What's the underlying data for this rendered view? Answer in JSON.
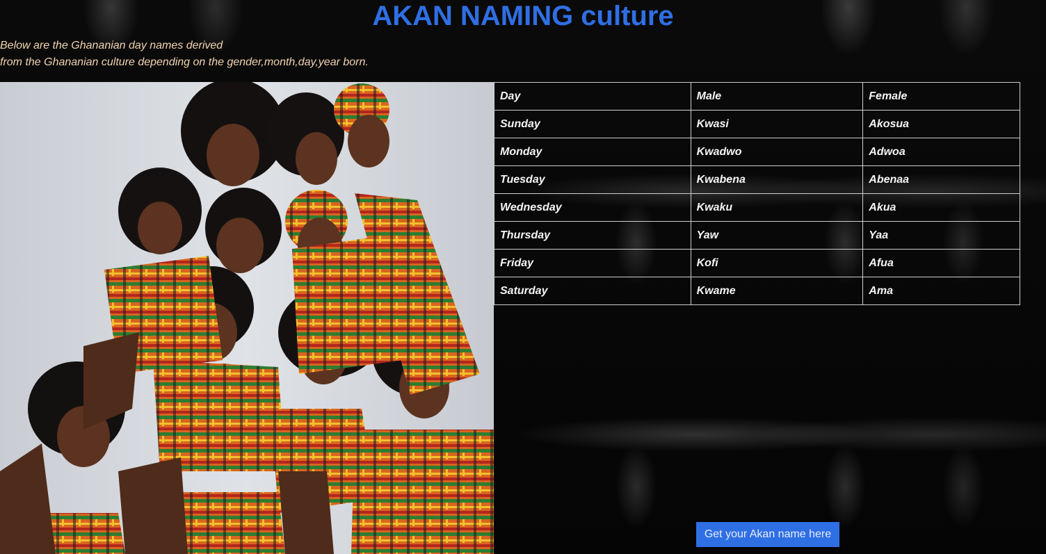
{
  "page": {
    "title": "AKAN NAMING culture",
    "intro_line1": "Below are the Ghananian day names derived",
    "intro_line2": "from the Ghananian culture depending on the gender,month,day,year born."
  },
  "table": {
    "headers": {
      "day": "Day",
      "male": "Male",
      "female": "Female"
    },
    "rows": [
      {
        "day": "Sunday",
        "male": "Kwasi",
        "female": "Akosua"
      },
      {
        "day": "Monday",
        "male": "Kwadwo",
        "female": "Adwoa"
      },
      {
        "day": "Tuesday",
        "male": "Kwabena",
        "female": "Abenaa"
      },
      {
        "day": "Wednesday",
        "male": "Kwaku",
        "female": "Akua"
      },
      {
        "day": "Thursday",
        "male": "Yaw",
        "female": "Yaa"
      },
      {
        "day": "Friday",
        "male": "Kofi",
        "female": "Afua"
      },
      {
        "day": "Saturday",
        "male": "Kwame",
        "female": "Ama"
      }
    ]
  },
  "cta": {
    "label": "Get your Akan name here"
  },
  "colors": {
    "title": "#2f6fe4",
    "intro_text": "#f3d4b0",
    "button": "#2f6fe4",
    "background": "#060606"
  }
}
